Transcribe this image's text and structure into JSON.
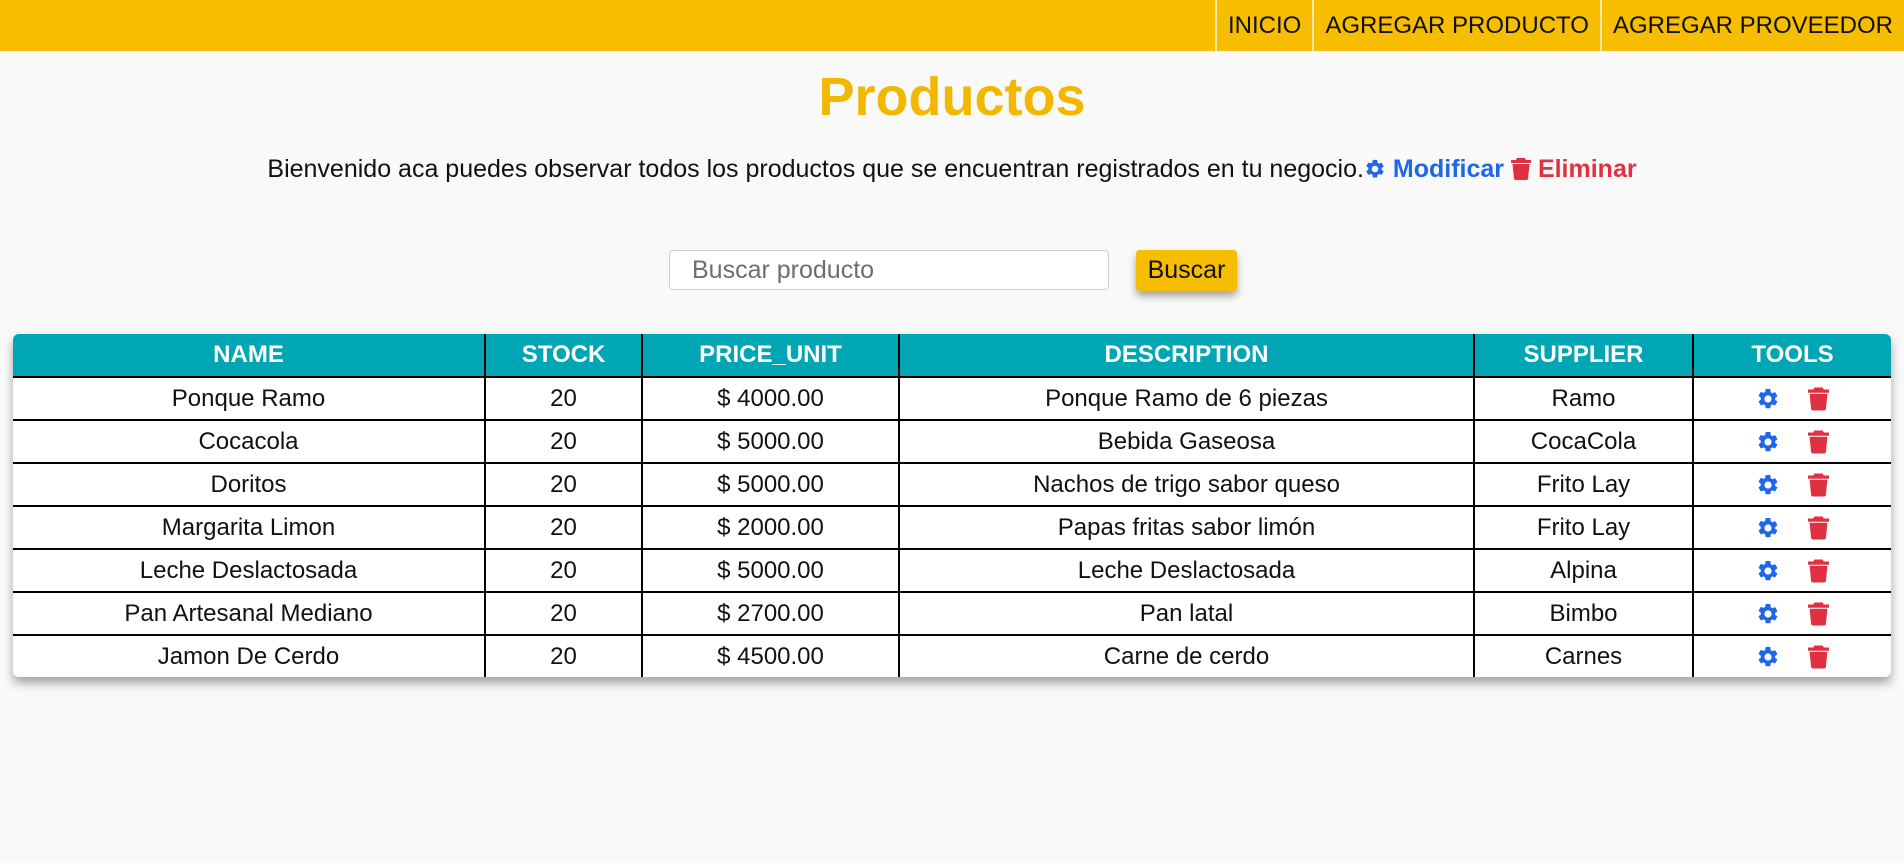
{
  "nav": {
    "items": [
      {
        "label": "INICIO"
      },
      {
        "label": "AGREGAR PRODUCTO"
      },
      {
        "label": "AGREGAR PROVEEDOR"
      }
    ]
  },
  "page": {
    "title": "Productos",
    "intro_text": "Bienvenido aca puedes observar todos los productos que se encuentran registrados en tu negocio.",
    "modify_label": "Modificar",
    "delete_label": "Eliminar"
  },
  "search": {
    "placeholder": "Buscar producto",
    "value": "",
    "button_label": "Buscar"
  },
  "table": {
    "headers": [
      "NAME",
      "STOCK",
      "PRICE_UNIT",
      "DESCRIPTION",
      "SUPPLIER",
      "TOOLS"
    ],
    "rows": [
      {
        "name": "Ponque Ramo",
        "stock": "20",
        "price": "$ 4000.00",
        "description": "Ponque Ramo de 6 piezas",
        "supplier": "Ramo"
      },
      {
        "name": "Cocacola",
        "stock": "20",
        "price": "$ 5000.00",
        "description": "Bebida Gaseosa",
        "supplier": "CocaCola"
      },
      {
        "name": "Doritos",
        "stock": "20",
        "price": "$ 5000.00",
        "description": "Nachos de trigo sabor queso",
        "supplier": "Frito Lay"
      },
      {
        "name": "Margarita Limon",
        "stock": "20",
        "price": "$ 2000.00",
        "description": "Papas fritas sabor limón",
        "supplier": "Frito Lay"
      },
      {
        "name": "Leche Deslactosada",
        "stock": "20",
        "price": "$ 5000.00",
        "description": "Leche Deslactosada",
        "supplier": "Alpina"
      },
      {
        "name": "Pan Artesanal Mediano",
        "stock": "20",
        "price": "$ 2700.00",
        "description": "Pan latal",
        "supplier": "Bimbo"
      },
      {
        "name": "Jamon De Cerdo",
        "stock": "20",
        "price": "$ 4500.00",
        "description": "Carne de cerdo",
        "supplier": "Carnes"
      }
    ]
  },
  "icons": {
    "modify": "gear-icon",
    "delete": "trash-icon"
  },
  "colors": {
    "accent": "#f7bd00",
    "title": "#f2b800",
    "table_header": "#00a6b4",
    "modify": "#1f66e8",
    "delete": "#df3142"
  }
}
